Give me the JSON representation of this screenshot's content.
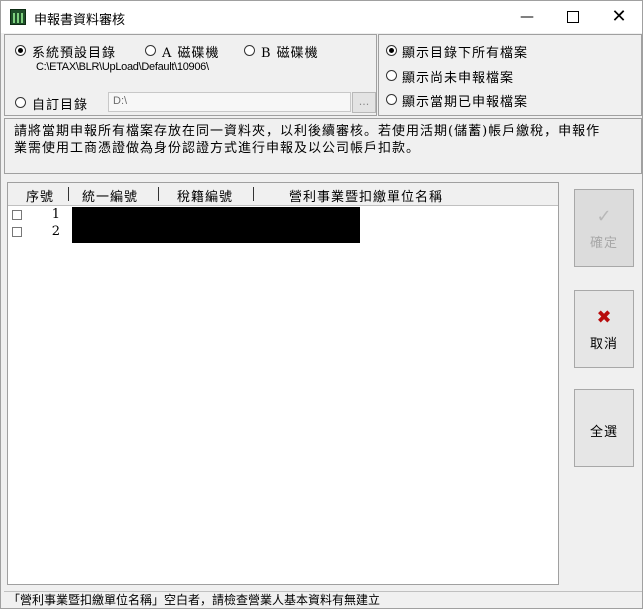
{
  "window": {
    "title": "申報書資料審核",
    "minimize_glyph": "—",
    "close_glyph": "✕"
  },
  "source": {
    "radio_default_label": "系統預設目錄",
    "radio_default_selected": true,
    "radio_a_label": "A 磁碟機",
    "radio_b_label": "B 磁碟機",
    "default_path": "C:\\ETAX\\BLR\\UpLoad\\Default\\10906\\",
    "radio_custom_label": "自訂目錄",
    "custom_value": "D:\\",
    "browse_label": "..."
  },
  "filter": {
    "options": [
      {
        "label": "顯示目錄下所有檔案",
        "selected": true
      },
      {
        "label": "顯示尚未申報檔案",
        "selected": false
      },
      {
        "label": "顯示當期已申報檔案",
        "selected": false
      }
    ]
  },
  "message": "請將當期申報所有檔案存放在同一資料夾，以利後續審核。若使用活期(儲蓄)帳戶繳稅，申報作業需使用工商憑證做為身份認證方式進行申報及以公司帳戶扣款。",
  "list": {
    "columns": [
      "序號",
      "統一編號",
      "稅籍編號",
      "營利事業暨扣繳單位名稱"
    ],
    "rows": [
      {
        "seq": "1",
        "checked": false
      },
      {
        "seq": "2",
        "checked": false
      }
    ]
  },
  "buttons": {
    "confirm": {
      "label": "確定",
      "icon": "check-icon"
    },
    "cancel": {
      "label": "取消",
      "icon": "x-icon"
    },
    "select_all": {
      "label": "全選"
    }
  },
  "status_text": "「營利事業暨扣繳單位名稱」空白者，請檢查營業人基本資料有無建立",
  "colors": {
    "cancel_icon": "#b80d0d",
    "disabled_text": "#a8a8a8",
    "redaction": "#000000"
  }
}
